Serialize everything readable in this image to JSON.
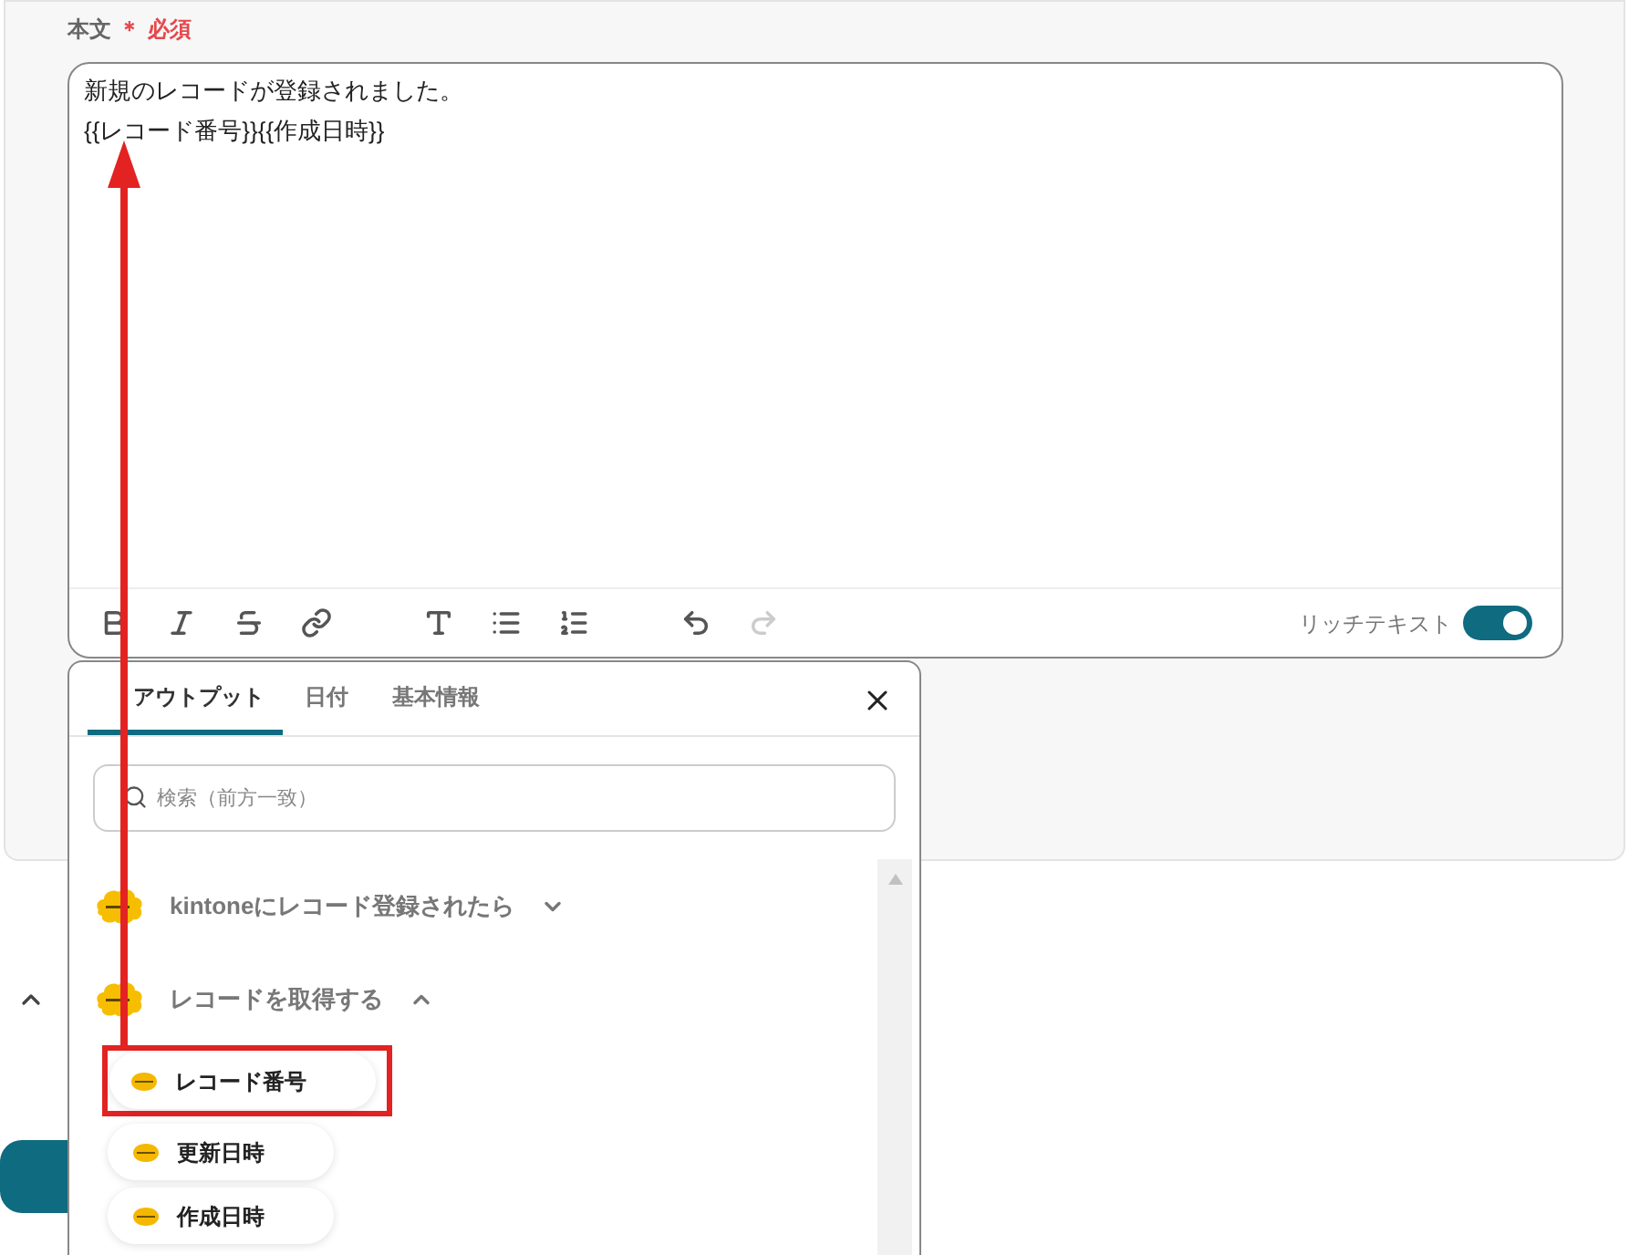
{
  "field": {
    "label": "本文",
    "required_mark": "＊",
    "required_text": "必須"
  },
  "editor": {
    "lines": [
      "新規のレコードが登録されました。",
      "{{レコード番号}}{{作成日時}}"
    ],
    "toolbar": [
      {
        "kind": "bold",
        "disabled": false
      },
      {
        "kind": "italic",
        "disabled": false
      },
      {
        "kind": "strike",
        "disabled": false
      },
      {
        "kind": "link",
        "disabled": false
      },
      {
        "kind": "size",
        "disabled": false
      },
      {
        "kind": "bullets",
        "disabled": false
      },
      {
        "kind": "numbers",
        "disabled": false
      },
      {
        "kind": "undo",
        "disabled": false
      },
      {
        "kind": "redo",
        "disabled": true
      }
    ],
    "rich_text": {
      "label": "リッチテキスト",
      "on": true
    }
  },
  "popup": {
    "tabs": [
      {
        "label": "アウトプット",
        "selected": true
      },
      {
        "label": "日付",
        "selected": false
      },
      {
        "label": "基本情報",
        "selected": false
      }
    ],
    "search": {
      "placeholder": "検索（前方一致）"
    },
    "groups": [
      {
        "title": "kintoneにレコード登録されたら",
        "expanded": false
      },
      {
        "title": "レコードを取得する",
        "expanded": true,
        "items": [
          {
            "label": "レコード番号",
            "highlighted": true
          },
          {
            "label": "更新日時",
            "highlighted": false
          },
          {
            "label": "作成日時",
            "highlighted": false
          }
        ]
      }
    ]
  }
}
